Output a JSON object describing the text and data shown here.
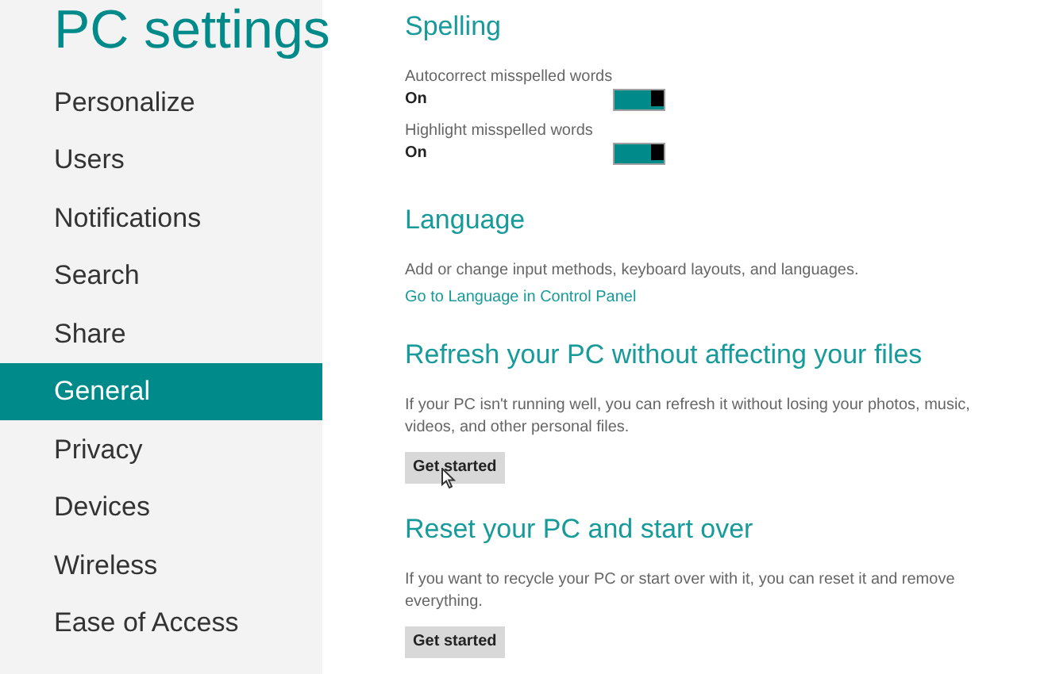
{
  "sidebar": {
    "title": "PC settings",
    "items": [
      {
        "label": "Personalize",
        "selected": false
      },
      {
        "label": "Users",
        "selected": false
      },
      {
        "label": "Notifications",
        "selected": false
      },
      {
        "label": "Search",
        "selected": false
      },
      {
        "label": "Share",
        "selected": false
      },
      {
        "label": "General",
        "selected": true
      },
      {
        "label": "Privacy",
        "selected": false
      },
      {
        "label": "Devices",
        "selected": false
      },
      {
        "label": "Wireless",
        "selected": false
      },
      {
        "label": "Ease of Access",
        "selected": false
      }
    ]
  },
  "sections": [
    {
      "title": "Spelling",
      "toggles": [
        {
          "label": "Autocorrect misspelled words",
          "value": "On",
          "on": true
        },
        {
          "label": "Highlight misspelled words",
          "value": "On",
          "on": true
        }
      ]
    },
    {
      "title": "Language",
      "description": "Add or change input methods, keyboard layouts, and languages.",
      "link": "Go to Language in Control Panel"
    },
    {
      "title": "Refresh your PC without affecting your files",
      "description": "If your PC isn't running well, you can refresh it without losing your photos, music, videos, and other personal files.",
      "button": "Get started",
      "pointer": true
    },
    {
      "title": "Reset your PC and start over",
      "description": "If you want to recycle your PC or start over with it, you can reset it and remove everything.",
      "button": "Get started",
      "pointer": false
    }
  ]
}
